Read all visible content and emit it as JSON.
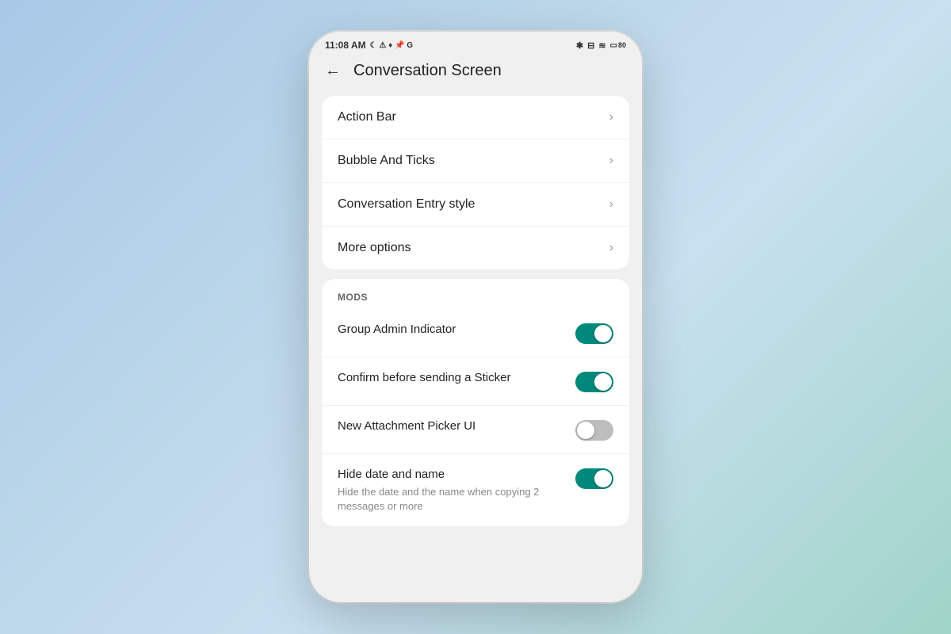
{
  "statusBar": {
    "time": "11:08 AM",
    "icons": "☾ 🔔 📌 G",
    "rightIcons": "✱ ⊟ ≋ 80"
  },
  "header": {
    "backArrow": "←",
    "title": "Conversation Screen"
  },
  "menuCard": {
    "items": [
      {
        "label": "Action Bar",
        "hasChevron": true
      },
      {
        "label": "Bubble And Ticks",
        "hasChevron": true
      },
      {
        "label": "Conversation Entry style",
        "hasChevron": true
      },
      {
        "label": "More options",
        "hasChevron": true
      }
    ]
  },
  "modsCard": {
    "sectionLabel": "MODS",
    "toggleItems": [
      {
        "title": "Group Admin Indicator",
        "subtitle": "",
        "state": "on"
      },
      {
        "title": "Confirm before sending a Sticker",
        "subtitle": "",
        "state": "on"
      },
      {
        "title": "New Attachment Picker UI",
        "subtitle": "",
        "state": "off"
      },
      {
        "title": "Hide date and name",
        "subtitle": "Hide the date and the name when copying 2 messages or more",
        "state": "on"
      }
    ]
  },
  "icons": {
    "chevron": "›",
    "back": "←"
  }
}
